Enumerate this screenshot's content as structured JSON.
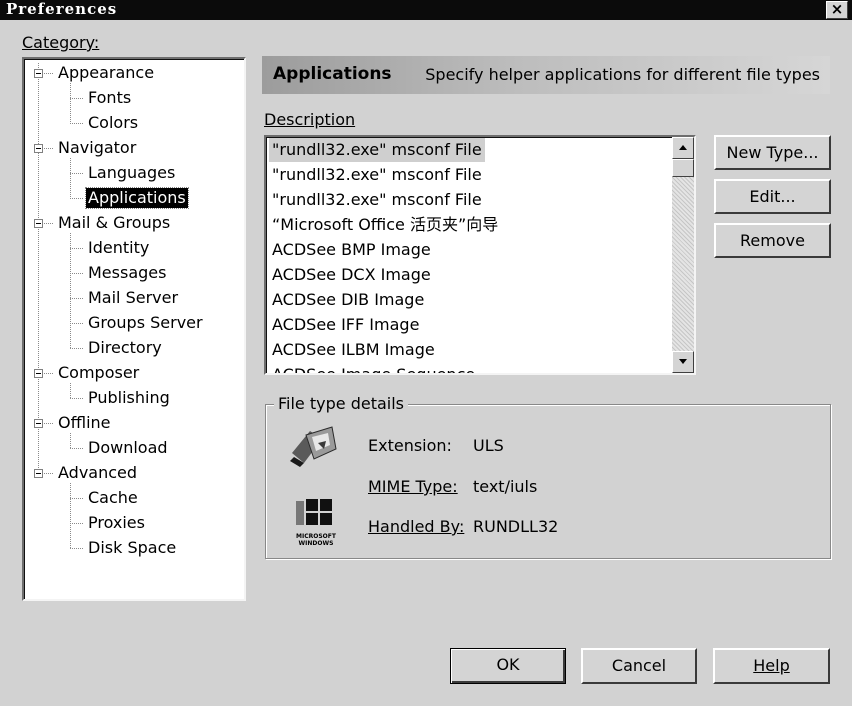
{
  "window": {
    "title": "Preferences",
    "close_glyph": "×"
  },
  "category": {
    "label": "Category:",
    "items": [
      {
        "label": "Appearance",
        "level": 0
      },
      {
        "label": "Fonts",
        "level": 1
      },
      {
        "label": "Colors",
        "level": 1
      },
      {
        "label": "Navigator",
        "level": 0
      },
      {
        "label": "Languages",
        "level": 1
      },
      {
        "label": "Applications",
        "level": 1,
        "selected": true
      },
      {
        "label": "Mail & Groups",
        "level": 0
      },
      {
        "label": "Identity",
        "level": 1
      },
      {
        "label": "Messages",
        "level": 1
      },
      {
        "label": "Mail Server",
        "level": 1
      },
      {
        "label": "Groups Server",
        "level": 1
      },
      {
        "label": "Directory",
        "level": 1
      },
      {
        "label": "Composer",
        "level": 0
      },
      {
        "label": "Publishing",
        "level": 1
      },
      {
        "label": "Offline",
        "level": 0
      },
      {
        "label": "Download",
        "level": 1
      },
      {
        "label": "Advanced",
        "level": 0
      },
      {
        "label": "Cache",
        "level": 1
      },
      {
        "label": "Proxies",
        "level": 1
      },
      {
        "label": "Disk Space",
        "level": 1
      }
    ]
  },
  "header": {
    "title": "Applications",
    "description": "Specify helper applications for different file types"
  },
  "description": {
    "label": "Description",
    "items": [
      "\"rundll32.exe\" msconf File",
      "\"rundll32.exe\" msconf File",
      "\"rundll32.exe\" msconf File",
      "“Microsoft Office 活页夹”向导",
      "ACDSee BMP Image",
      "ACDSee DCX Image",
      "ACDSee DIB Image",
      "ACDSee IFF Image",
      "ACDSee ILBM Image",
      "ACDSee Image Sequence"
    ],
    "selected_index": 0
  },
  "side_buttons": {
    "new_type": "New Type...",
    "edit": "Edit...",
    "remove": "Remove"
  },
  "details": {
    "title": "File type details",
    "extension_label": "Extension:",
    "extension_value": "ULS",
    "mime_label": "MIME Type:",
    "mime_value": "text/iuls",
    "handled_label": "Handled By:",
    "handled_value": "RUNDLL32",
    "file_icon": "file-type-icon",
    "handler_logo": "microsoft-windows-logo",
    "logo_text_1": "MICROSOFT",
    "logo_text_2": "WINDOWS"
  },
  "footer": {
    "ok": "OK",
    "cancel": "Cancel",
    "help": "Help"
  }
}
